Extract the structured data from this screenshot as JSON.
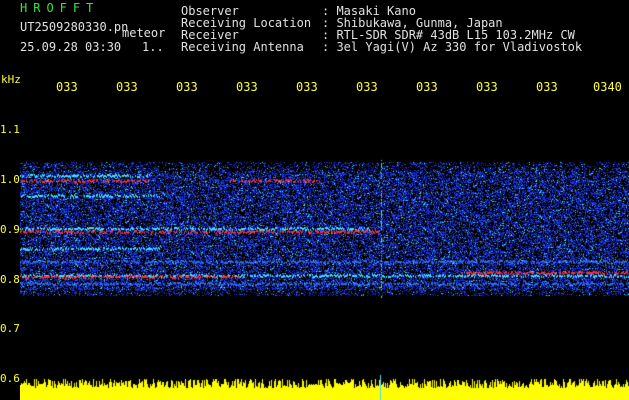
{
  "app": {
    "title": "HROFFT",
    "file_name": "UT2509280330.pn",
    "mode": "meteor",
    "timestamp": "25.09.28 03:30",
    "page_index": "1.."
  },
  "info": {
    "observer_key": "Observer",
    "observer_val": ": Masaki Kano",
    "location_key": "Receiving Location",
    "location_val": ": Shibukawa, Gunma, Japan",
    "receiver_key": "Receiver",
    "receiver_val": ": RTL-SDR SDR# 43dB L15 103.2MHz CW",
    "antenna_key": "Receiving Antenna",
    "antenna_val": ": 3el Yagi(V) Az 330 for Vladivostok"
  },
  "axis": {
    "y_unit": "kHz",
    "y_ticks": [
      "1.1",
      "1.0",
      "0.9",
      "0.8",
      "0.7",
      "0.6"
    ],
    "x_ticks": [
      "033",
      "033",
      "033",
      "033",
      "033",
      "033",
      "033",
      "033",
      "033",
      "0340"
    ]
  },
  "colors": {
    "title": "#36e536",
    "axis": "#ffff33",
    "signal_low": "#1a2fd6",
    "signal_mid": "#3fe0ff",
    "signal_high": "#ff3030",
    "trace": "#ffff00"
  }
}
